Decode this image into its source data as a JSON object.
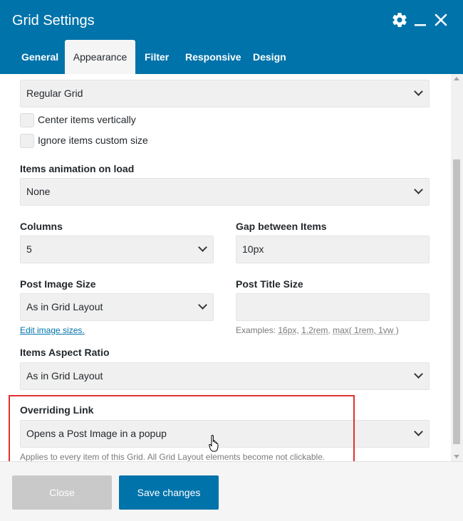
{
  "header": {
    "title": "Grid Settings",
    "icons": [
      "gear-icon",
      "minimize-icon",
      "close-icon"
    ],
    "background": "#0073aa"
  },
  "tabs": [
    {
      "label": "General",
      "active": false
    },
    {
      "label": "Appearance",
      "active": true
    },
    {
      "label": "Filter",
      "active": false
    },
    {
      "label": "Responsive",
      "active": false
    },
    {
      "label": "Design",
      "active": false
    }
  ],
  "form": {
    "layout_select": {
      "value": "Regular Grid"
    },
    "center_vertically": {
      "label": "Center items vertically",
      "checked": false
    },
    "ignore_custom_size": {
      "label": "Ignore items custom size",
      "checked": false
    },
    "animation": {
      "label": "Items animation on load",
      "value": "None"
    },
    "columns": {
      "label": "Columns",
      "value": "5"
    },
    "gap": {
      "label": "Gap between Items",
      "value": "10px"
    },
    "image_size": {
      "label": "Post Image Size",
      "value": "As in Grid Layout",
      "link": "Edit image sizes",
      "link_suffix": "."
    },
    "title_size": {
      "label": "Post Title Size",
      "value": "",
      "help_prefix": "Examples: ",
      "ex1": "16px",
      "sep": ", ",
      "ex2": "1.2rem",
      "ex3": "max( 1rem, 1vw )"
    },
    "aspect_ratio": {
      "label": "Items Aspect Ratio",
      "value": "As in Grid Layout"
    },
    "overriding_link": {
      "label": "Overriding Link",
      "value": "Opens a Post Image in a popup",
      "help": "Applies to every item of this Grid. All Grid Layout elements become not clickable."
    }
  },
  "footer": {
    "close_label": "Close",
    "save_label": "Save changes"
  },
  "colors": {
    "accent": "#0073aa",
    "highlight": "#e03131",
    "field_bg": "#f0f0f0"
  }
}
